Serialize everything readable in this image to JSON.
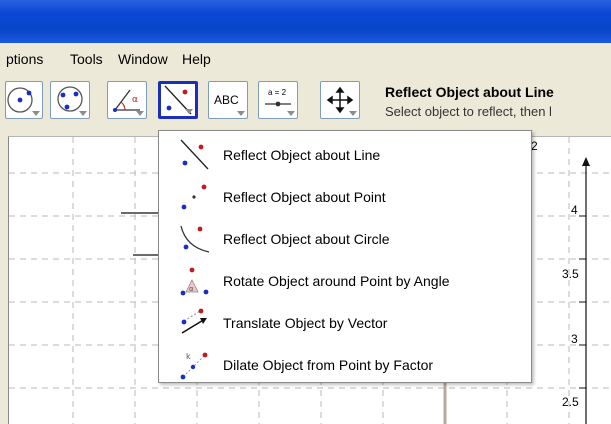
{
  "menu": {
    "items": [
      "ptions",
      "Tools",
      "Window",
      "Help"
    ]
  },
  "toolbar": {
    "text_tool_label": "ABC",
    "slider_tool_label": "a = 2",
    "active_tool_title": "Reflect Object about Line",
    "active_tool_help": "Select object to reflect, then l"
  },
  "dropdown": {
    "items": [
      {
        "label": "Reflect Object about Line",
        "icon": "reflect-line-icon"
      },
      {
        "label": "Reflect Object about Point",
        "icon": "reflect-point-icon"
      },
      {
        "label": "Reflect Object about Circle",
        "icon": "reflect-circle-icon"
      },
      {
        "label": "Rotate Object around Point by Angle",
        "icon": "rotate-icon"
      },
      {
        "label": "Translate Object by Vector",
        "icon": "translate-icon"
      },
      {
        "label": "Dilate Object from Point by Factor",
        "icon": "dilate-icon"
      }
    ]
  },
  "axis": {
    "x_label_partial": "2",
    "y_ticks": [
      "4",
      "3.5",
      "3",
      "2.5"
    ]
  },
  "colors": {
    "point_blue": "#1a2ec4",
    "point_red": "#c41a1a",
    "selected_border": "#1c2fb8"
  }
}
